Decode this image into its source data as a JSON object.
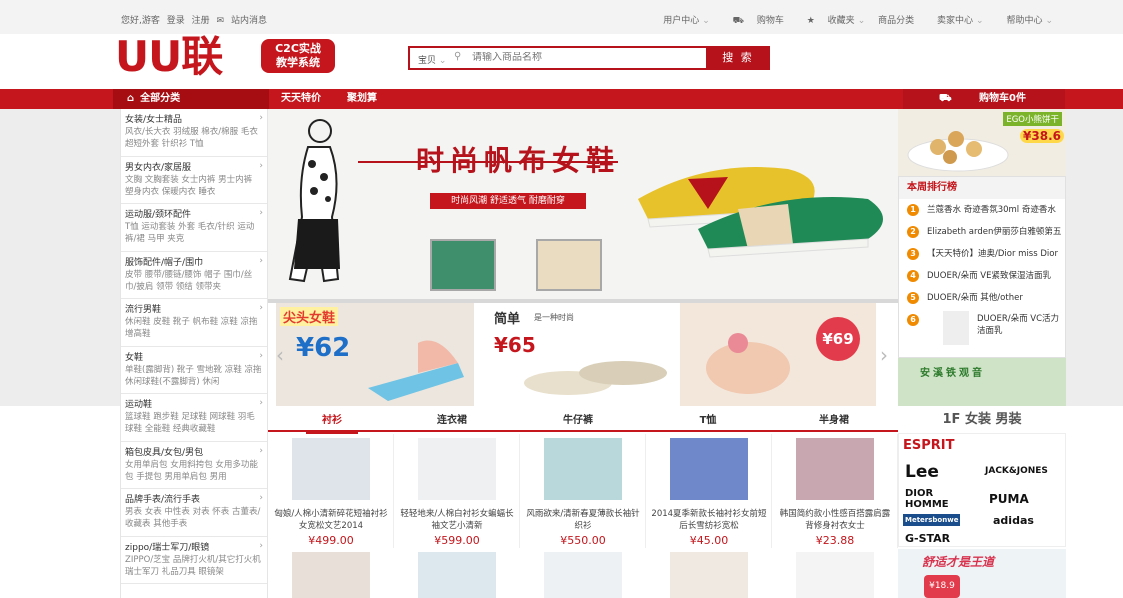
{
  "topbar": {
    "greeting": "您好,游客",
    "login": "登录",
    "register": "注册",
    "messages": "站内消息",
    "user_center": "用户中心",
    "cart": "购物车",
    "favorites": "收藏夹",
    "categories": "商品分类",
    "seller_center": "卖家中心",
    "help_center": "帮助中心"
  },
  "header": {
    "logo_text": "UU联",
    "badge_line1": "C2C实战",
    "badge_line2": "教学系统"
  },
  "search": {
    "category": "宝贝",
    "placeholder": "请输入商品名称",
    "button": "搜 索"
  },
  "nav": {
    "all_categories": "全部分类",
    "links": [
      "天天特价",
      "聚划算"
    ],
    "cart": "购物车0件"
  },
  "categories": [
    {
      "title": "女装/女士精品",
      "sub": "风衣/长大衣 羽绒服 棉衣/棉服 毛衣 超短外套 针织衫 T恤"
    },
    {
      "title": "男女内衣/家居服",
      "sub": "文胸 文胸套装 女士内裤 男士内裤 塑身内衣 保暖内衣 睡衣"
    },
    {
      "title": "运动服/颈环配件",
      "sub": "T恤 运动套装 外套 毛衣/针织 运动裤/裙 马甲 夹克"
    },
    {
      "title": "服饰配件/帽子/围巾",
      "sub": "皮带 腰带/腰链/腰饰 帽子 围巾/丝巾/披肩 领带 领结 领带夹"
    },
    {
      "title": "流行男鞋",
      "sub": "休闲鞋 皮鞋 靴子 帆布鞋 凉鞋 凉拖 增高鞋"
    },
    {
      "title": "女鞋",
      "sub": "单鞋(露脚背) 靴子 雪地靴 凉鞋 凉拖 休闲球鞋(不露脚背) 休闲"
    },
    {
      "title": "运动鞋",
      "sub": "篮球鞋 跑步鞋 足球鞋 网球鞋 羽毛球鞋 全能鞋 经典收藏鞋"
    },
    {
      "title": "箱包皮具/女包/男包",
      "sub": "女用单肩包 女用斜挎包 女用多功能包 手提包 男用单肩包 男用"
    },
    {
      "title": "品牌手表/流行手表",
      "sub": "男表 女表 中性表 对表 怀表 古董表/收藏表 其他手表"
    },
    {
      "title": "zippo/瑞士军刀/眼镜",
      "sub": "ZIPPO/芝宝 品牌打火机/其它打火机 瑞士军刀 礼品刀具 眼镜架"
    }
  ],
  "banner": {
    "title": "时尚帆布女鞋",
    "subtitle": "时尚风潮  舒适透气  耐磨耐穿"
  },
  "promo": {
    "tag1": "尖头女鞋",
    "price1": "¥62",
    "tag2": "简单",
    "tag2_sub": "是一种时尚",
    "price2": "¥65",
    "price3": "¥69"
  },
  "right": {
    "ad_tag": "EGO小熊饼干",
    "ad_price": "¥38.6",
    "rank_title": "本周排行榜",
    "rank": [
      {
        "n": "1",
        "text": "兰蔻香水 奇迹香氛30ml 奇迹香水"
      },
      {
        "n": "2",
        "text": "Elizabeth arden伊丽莎白雅顿第五"
      },
      {
        "n": "3",
        "text": "【天天特价】迪奥/Dior miss Dior"
      },
      {
        "n": "4",
        "text": "DUOER/朵而 VE紧致保湿洁面乳"
      },
      {
        "n": "5",
        "text": "DUOER/朵而 其他/other"
      },
      {
        "n": "6",
        "text": "DUOER/朵而 VC活力洁面乳"
      }
    ],
    "ad2_text": "安溪铁观音",
    "floor_title": "1F 女装 男装",
    "brands": [
      "ESPRIT",
      "Lee",
      "JACK&JONES",
      "DIOR HOMME",
      "PUMA",
      "Metersbonwe",
      "adidas",
      "G-STAR"
    ],
    "ad3_text": "舒适才是王道",
    "ad3_price": "¥18.9"
  },
  "tabs": [
    "衬衫",
    "连衣裙",
    "牛仔裤",
    "T恤",
    "半身裙"
  ],
  "products": [
    {
      "name": "匈娘/人棉小清新碎花短袖衬衫女宽松文艺2014",
      "price": "¥499.00",
      "color": "#dfe4ea"
    },
    {
      "name": "轻轻地来/人棉白衬衫女蝙蝠长袖文艺小清新",
      "price": "¥599.00",
      "color": "#eef0f2"
    },
    {
      "name": "风雨欲来/清新春夏薄款长袖针织衫",
      "price": "¥550.00",
      "color": "#b9d8dc"
    },
    {
      "name": "2014夏季新款长袖衬衫女前短后长雪纺衫宽松",
      "price": "¥45.00",
      "color": "#6e88c9"
    },
    {
      "name": "韩国简约款小性感百搭露肩露背修身衬衣女士",
      "price": "¥23.88",
      "color": "#c9a7b1"
    }
  ],
  "products_row2_colors": [
    "#e8e0d8",
    "#dde7ee",
    "#eef1f4",
    "#f0e9e2",
    "#f4f4f4"
  ]
}
